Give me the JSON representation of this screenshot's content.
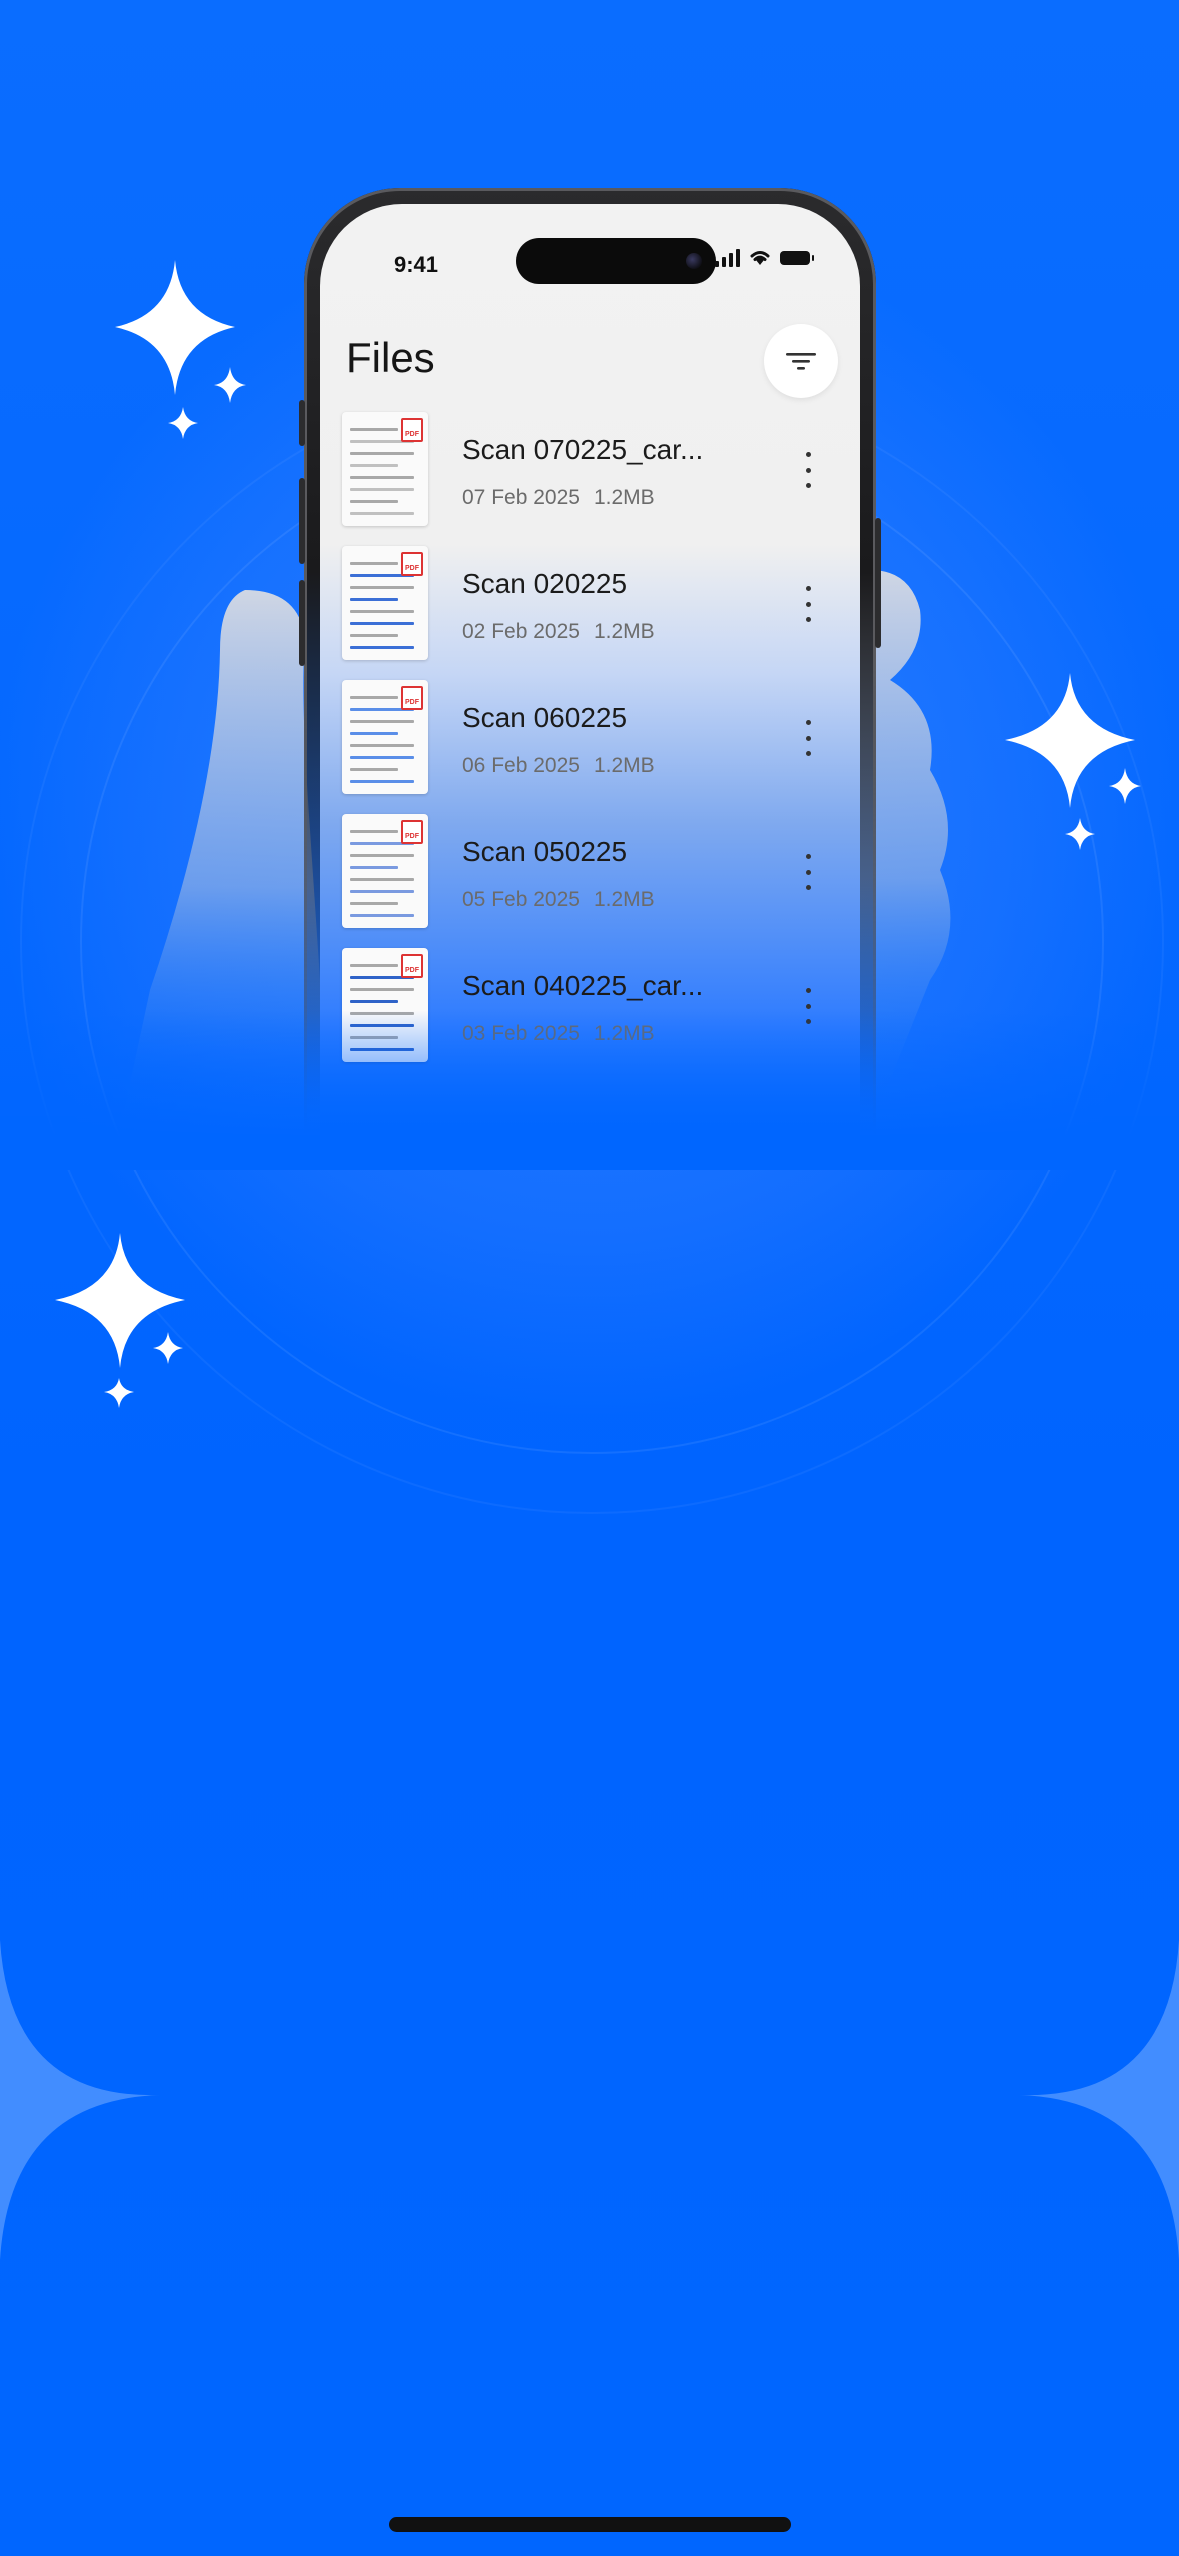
{
  "theme": {
    "background": "#0066ff",
    "screen_bg": "#f0f0f0",
    "sparkle": "#ffffff"
  },
  "status_bar": {
    "time": "9:41",
    "icons": [
      "signal-icon",
      "wifi-icon",
      "battery-icon"
    ]
  },
  "header": {
    "title": "Files",
    "filter_icon": "filter-icon"
  },
  "files": [
    {
      "name": "Scan 070225_car...",
      "date": "07 Feb 2025",
      "size": "1.2MB",
      "thumb_accent": "#c0c0c0"
    },
    {
      "name": "Scan 020225",
      "date": "02 Feb 2025",
      "size": "1.2MB",
      "thumb_accent": "#3b6fd6"
    },
    {
      "name": "Scan 060225",
      "date": "06 Feb 2025",
      "size": "1.2MB",
      "thumb_accent": "#5a8ee8"
    },
    {
      "name": "Scan 050225",
      "date": "05 Feb 2025",
      "size": "1.2MB",
      "thumb_accent": "#7a9ae0"
    },
    {
      "name": "Scan 040225_car...",
      "date": "03 Feb 2025",
      "size": "1.2MB",
      "thumb_accent": "#2f63c8"
    }
  ],
  "badge_label": "PDF"
}
